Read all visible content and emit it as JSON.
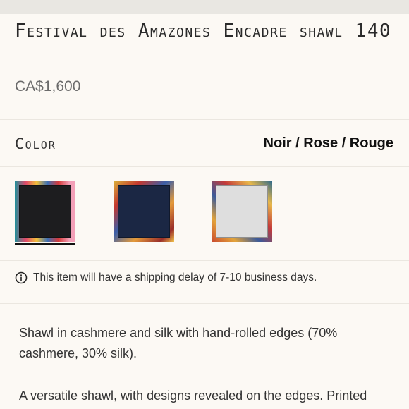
{
  "product": {
    "title": "Festival des Amazones Encadre shawl 140",
    "price": "CA$1,600"
  },
  "color": {
    "label": "Color",
    "selected_value": "Noir / Rose / Rouge",
    "swatches": [
      {
        "name": "Noir / Rose / Rouge",
        "center": "#1d1d1f",
        "selected": true
      },
      {
        "name": "Navy",
        "center": "#1b2744",
        "selected": false
      },
      {
        "name": "White",
        "center": "#dedede",
        "selected": false
      }
    ]
  },
  "notice": {
    "icon": "info-icon",
    "text": "This item will have a shipping delay of 7-10 business days."
  },
  "description": {
    "paragraph_1": "Shawl in cashmere and silk with hand-rolled edges (70% cashmere, 30% silk).",
    "paragraph_2": "A versatile shawl, with designs revealed on the edges. Printed"
  }
}
